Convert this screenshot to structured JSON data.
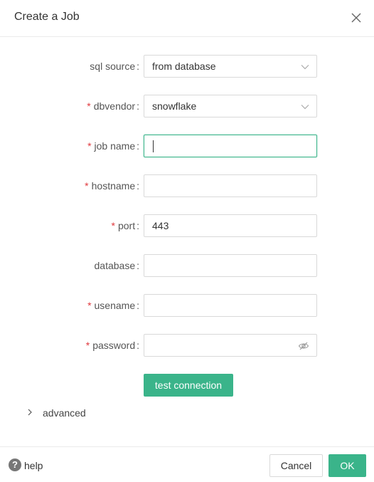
{
  "dialog": {
    "title": "Create a Job",
    "close_icon": "close-icon"
  },
  "form": {
    "sql_source": {
      "label": "sql source",
      "required": false,
      "value": "from database",
      "icon": "chevron-down-icon"
    },
    "dbvendor": {
      "label": "dbvendor",
      "required": true,
      "value": "snowflake",
      "icon": "chevron-down-icon"
    },
    "job_name": {
      "label": "job name",
      "required": true,
      "value": ""
    },
    "hostname": {
      "label": "hostname",
      "required": true,
      "value": ""
    },
    "port": {
      "label": "port",
      "required": true,
      "value": "443"
    },
    "database": {
      "label": "database",
      "required": false,
      "value": ""
    },
    "usename": {
      "label": "usename",
      "required": true,
      "value": ""
    },
    "password": {
      "label": "password",
      "required": true,
      "value": "",
      "icon": "eye-hidden-icon"
    },
    "required_marker": "*",
    "colon": ":"
  },
  "actions": {
    "test_connection": "test connection",
    "advanced": "advanced",
    "help": "help",
    "help_icon_glyph": "?",
    "cancel": "Cancel",
    "ok": "OK"
  },
  "colors": {
    "accent": "#3ab48a",
    "required": "#e0393e"
  }
}
